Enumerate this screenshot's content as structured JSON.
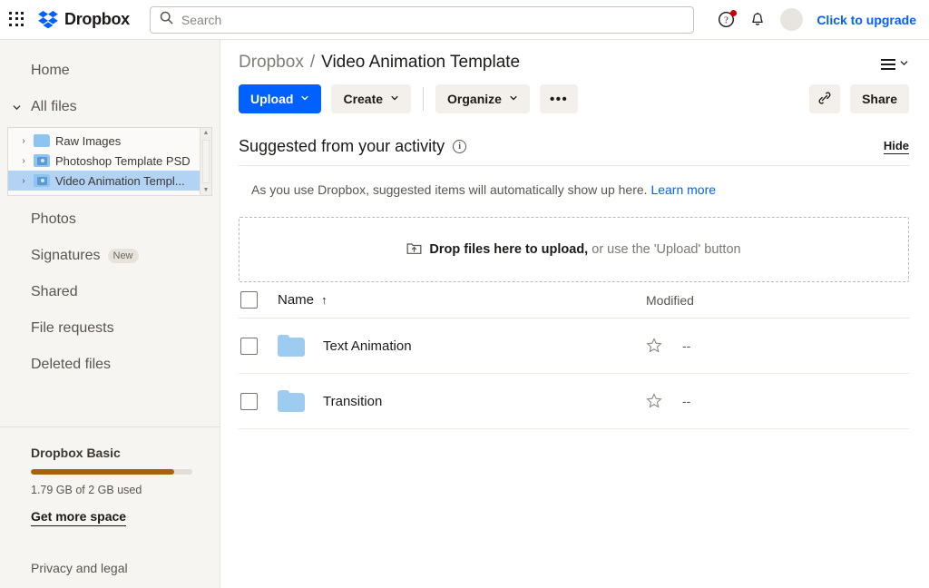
{
  "topbar": {
    "app_grid_icon": "grid-apps-icon",
    "logo_icon": "dropbox-logo-icon",
    "brand": "Dropbox",
    "search": {
      "placeholder": "Search",
      "value": "",
      "icon": "search-icon"
    },
    "help_icon": "help-circle-icon",
    "notifications_icon": "bell-icon",
    "avatar_icon": "user-avatar",
    "upgrade_label": "Click to upgrade",
    "upgrade_color": "#0061fe"
  },
  "sidebar": {
    "home": "Home",
    "all_files": "All files",
    "tree": [
      {
        "label": "Raw Images",
        "icon": "folder-icon",
        "shared": false,
        "selected": false
      },
      {
        "label": "Photoshop Template PSD",
        "icon": "shared-folder-icon",
        "shared": true,
        "selected": false
      },
      {
        "label": "Video Animation Templ...",
        "icon": "shared-folder-icon",
        "shared": true,
        "selected": true
      }
    ],
    "items": [
      {
        "label": "Photos",
        "badge": ""
      },
      {
        "label": "Signatures",
        "badge": "New"
      },
      {
        "label": "Shared",
        "badge": ""
      },
      {
        "label": "File requests",
        "badge": ""
      },
      {
        "label": "Deleted files",
        "badge": ""
      }
    ],
    "storage": {
      "plan": "Dropbox Basic",
      "used_text": "1.79 GB of 2 GB used",
      "percent": 89,
      "bar_color": "#a8630a",
      "get_more": "Get more space"
    },
    "privacy": "Privacy and legal"
  },
  "main": {
    "breadcrumb": {
      "root": "Dropbox",
      "separator": "/",
      "current": "Video Animation Template"
    },
    "view_toggle_icon": "list-view-icon",
    "toolbar": {
      "upload": "Upload",
      "create": "Create",
      "organize": "Organize",
      "more": "•••",
      "copy_link_icon": "link-icon",
      "share": "Share"
    },
    "suggested": {
      "title": "Suggested from your activity",
      "info_icon": "info-icon",
      "hide": "Hide",
      "body_text": "As you use Dropbox, suggested items will automatically show up here.",
      "learn_more": "Learn more"
    },
    "dropzone": {
      "icon": "upload-folder-icon",
      "bold_text": "Drop files here to upload,",
      "rest_text": "or use the 'Upload' button"
    },
    "table": {
      "columns": {
        "name": "Name",
        "sort_arrow": "↑",
        "modified": "Modified"
      },
      "rows": [
        {
          "name": "Text Animation",
          "icon": "folder-icon",
          "star": "star-outline-icon",
          "modified": "--"
        },
        {
          "name": "Transition",
          "icon": "folder-icon",
          "star": "star-outline-icon",
          "modified": "--"
        }
      ]
    }
  }
}
